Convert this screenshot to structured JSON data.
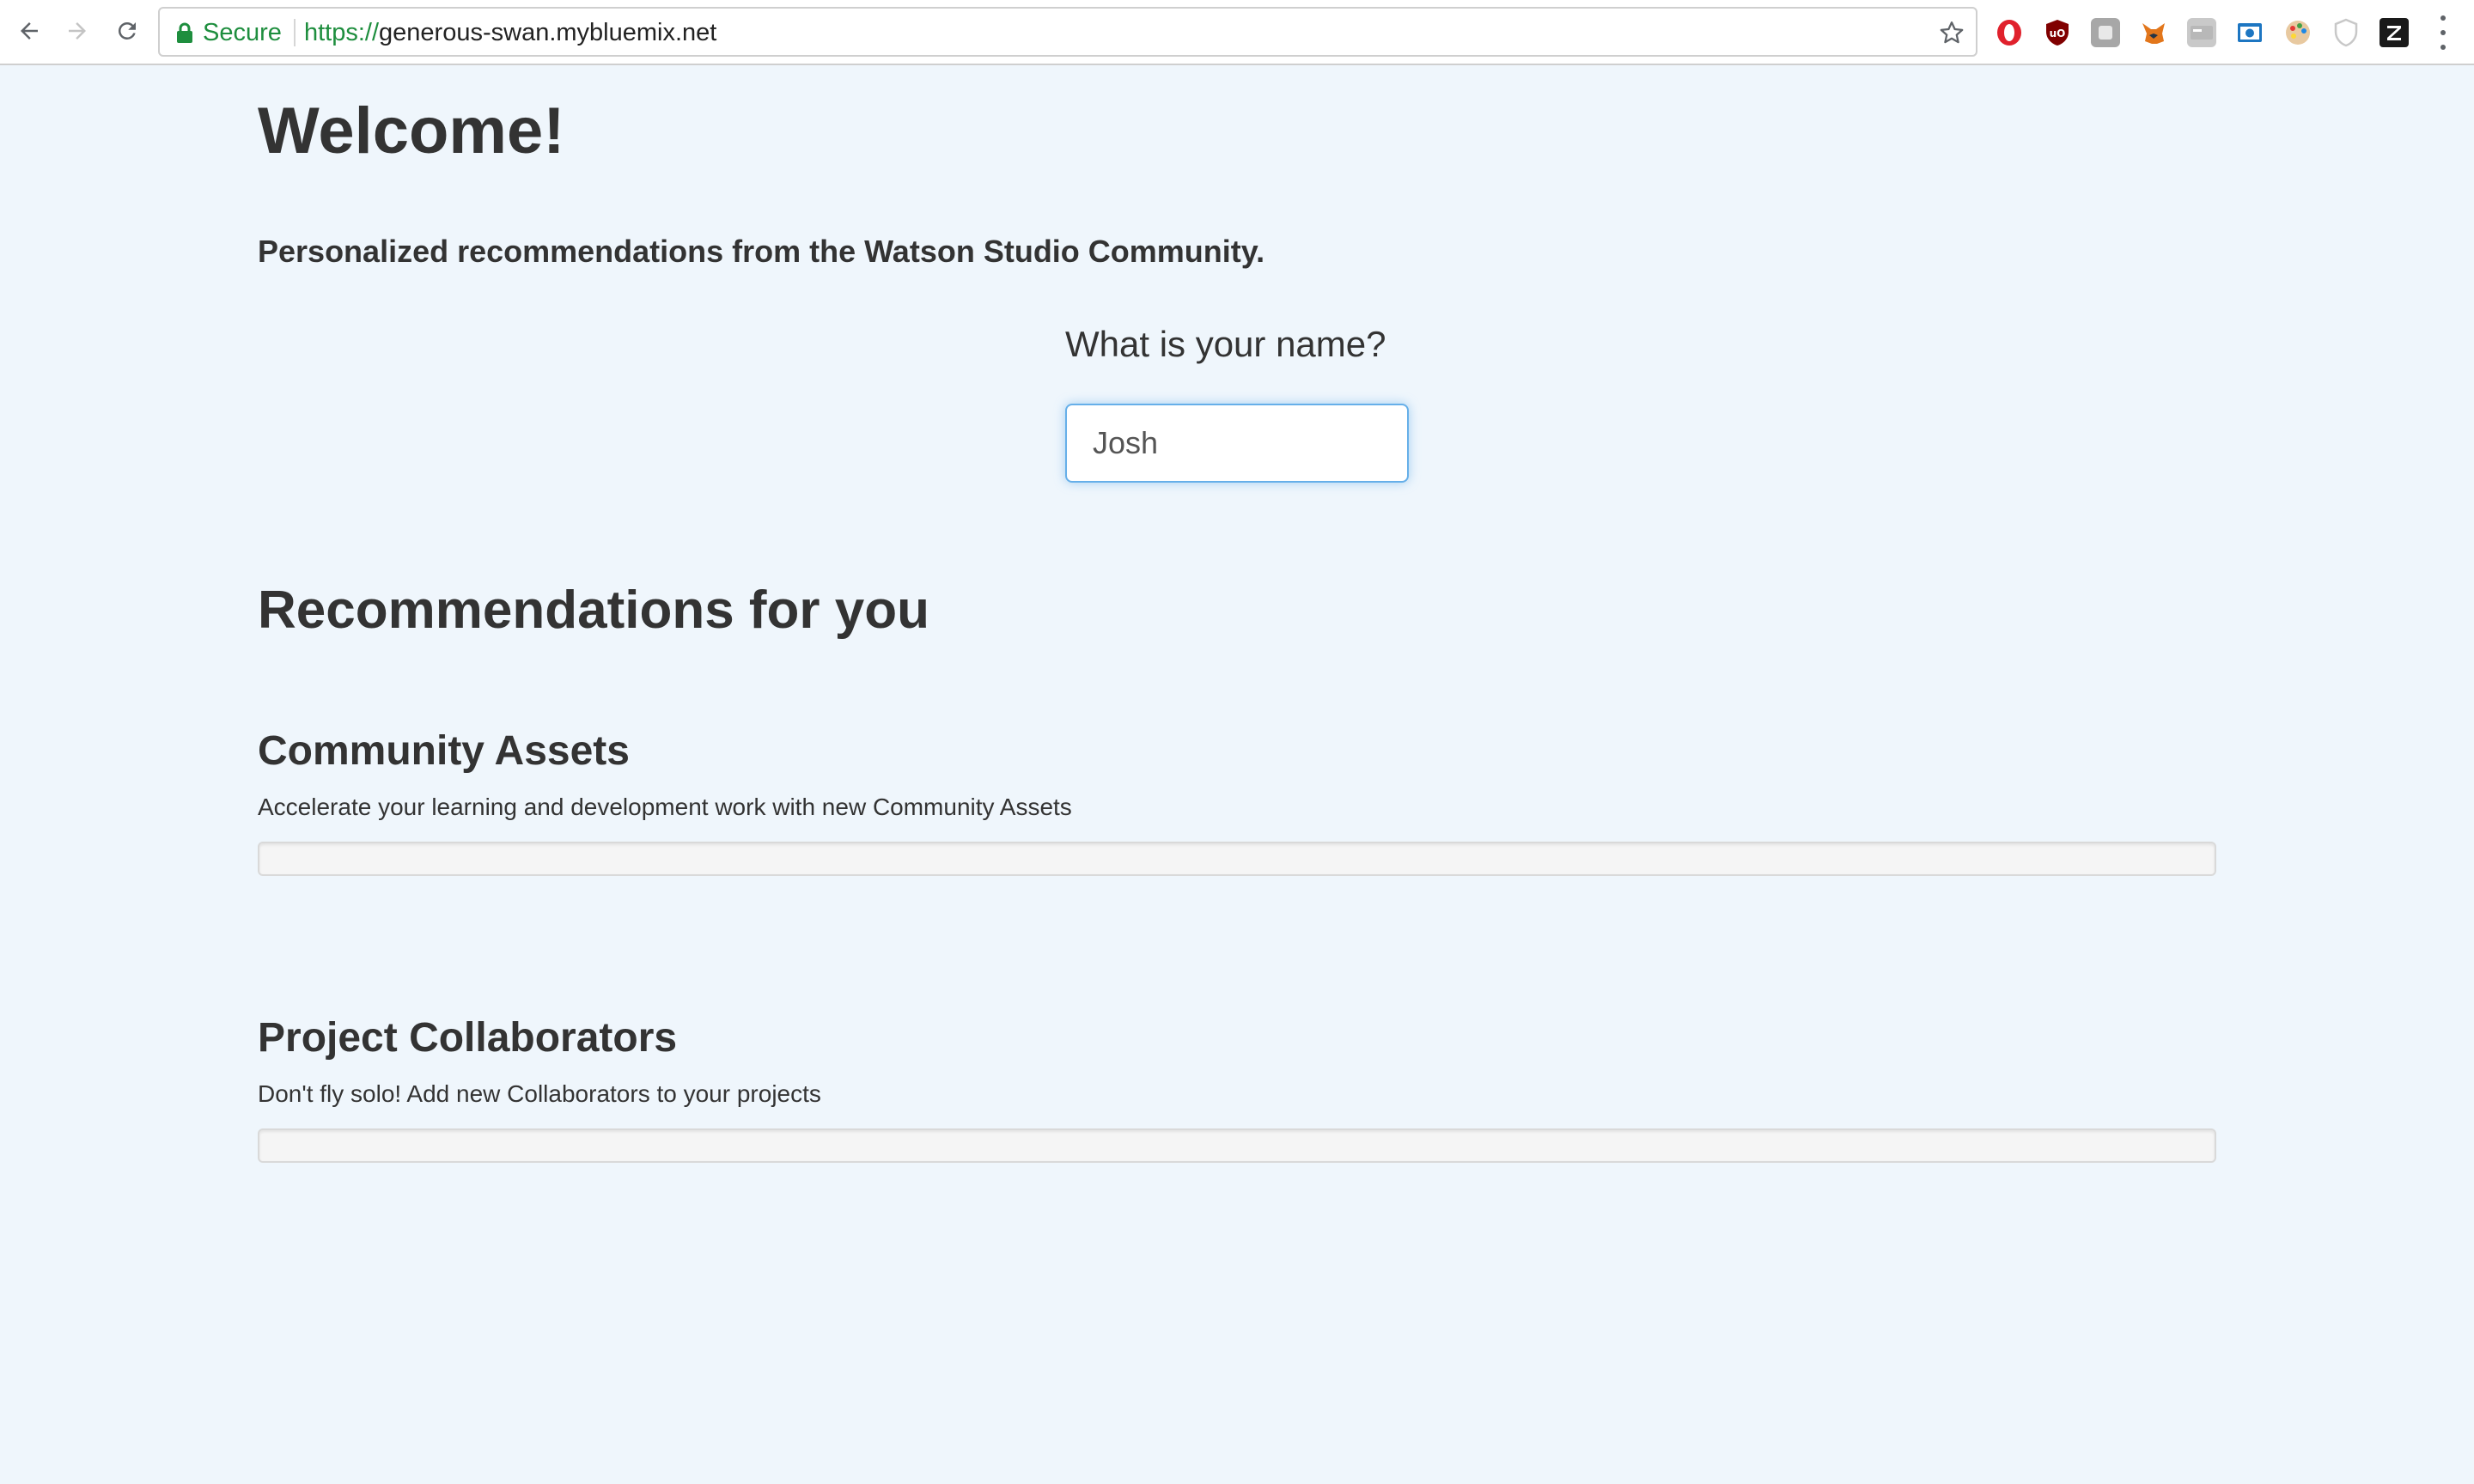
{
  "browser": {
    "secure_label": "Secure",
    "url_scheme": "https://",
    "url_host": "generous-swan.mybluemix.net",
    "nav": {
      "back_icon": "back-arrow-icon",
      "forward_icon": "forward-arrow-icon",
      "reload_icon": "reload-icon"
    },
    "extensions": [
      "opera-icon",
      "ublock-origin-icon",
      "grey-extension-icon",
      "metamask-fox-icon",
      "grey-card-extension-icon",
      "camera-extension-icon",
      "palette-extension-icon",
      "shield-extension-icon",
      "z-extension-icon"
    ],
    "colors": {
      "secure_green": "#1e8e3e",
      "chrome_bg": "#ffffff"
    }
  },
  "page": {
    "title": "Welcome!",
    "subtitle": "Personalized recommendations from the Watson Studio Community.",
    "name_prompt": {
      "question": "What is your name?",
      "value": "Josh"
    },
    "recommendations_title": "Recommendations for you",
    "sections": [
      {
        "heading": "Community Assets",
        "description": "Accelerate your learning and development work with new Community Assets",
        "progress": 0
      },
      {
        "heading": "Project Collaborators",
        "description": "Don't fly solo! Add new Collaborators to your projects",
        "progress": 0
      }
    ],
    "colors": {
      "background": "#eff6fc",
      "text": "#333333",
      "input_focus": "#66afe9"
    }
  }
}
